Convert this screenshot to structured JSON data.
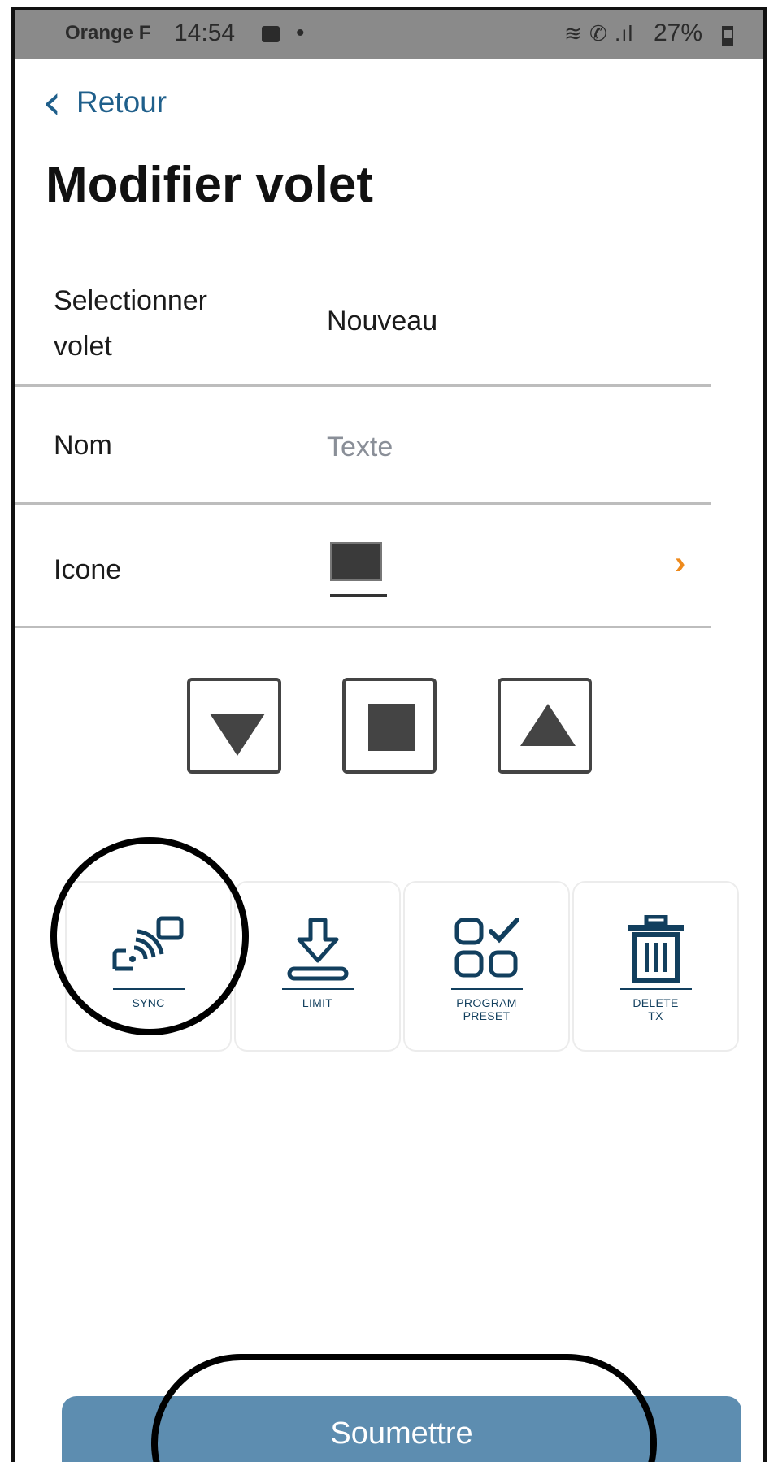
{
  "status_bar": {
    "carrier": "Orange F",
    "time": "14:54",
    "dot": "•",
    "signals": "≋ ✆ .ıl",
    "battery": "27%"
  },
  "nav": {
    "back_label": "Retour",
    "back_icon": "chevron-left-icon"
  },
  "page": {
    "title": "Modifier volet"
  },
  "form": {
    "select_label": "Selectionner volet",
    "select_value": "Nouveau",
    "name_label": "Nom",
    "name_placeholder": "Texte",
    "icon_label": "Icone",
    "accent_color": "#ee8a1c"
  },
  "controls": [
    "down-arrow-icon",
    "stop-icon",
    "up-arrow-icon"
  ],
  "actions": [
    {
      "icon": "sync-icon",
      "label_lines": [
        "SYNC"
      ]
    },
    {
      "icon": "limit-icon",
      "label_lines": [
        "LIMIT"
      ]
    },
    {
      "icon": "program-preset-icon",
      "label_lines": [
        "PROGRAM",
        "PRESET"
      ]
    },
    {
      "icon": "delete-icon",
      "label_lines": [
        "DELETE",
        "TX"
      ]
    }
  ],
  "submit": {
    "label": "Soumettre",
    "color": "#5d8db0"
  }
}
